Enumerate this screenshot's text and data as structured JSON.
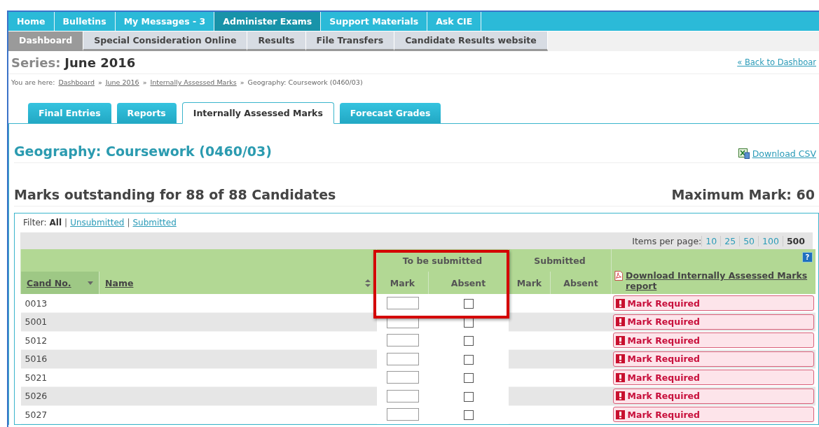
{
  "top_nav": [
    {
      "label": "Home",
      "selected": false
    },
    {
      "label": "Bulletins",
      "selected": false
    },
    {
      "label": "My Messages - 3",
      "selected": false
    },
    {
      "label": "Administer Exams",
      "selected": true
    },
    {
      "label": "Support Materials",
      "selected": false
    },
    {
      "label": "Ask CIE",
      "selected": false
    }
  ],
  "sub_nav": [
    {
      "label": "Dashboard",
      "selected": true
    },
    {
      "label": "Special Consideration Online",
      "selected": false
    },
    {
      "label": "Results",
      "selected": false
    },
    {
      "label": "File Transfers",
      "selected": false
    },
    {
      "label": "Candidate Results website",
      "selected": false
    }
  ],
  "series": {
    "label": "Series:",
    "value": "June 2016"
  },
  "back_link": "« Back to Dashboar",
  "breadcrumb": {
    "prefix": "You are here:",
    "separator": "»",
    "items": [
      {
        "label": "Dashboard",
        "link": true
      },
      {
        "label": "June 2016",
        "link": true
      },
      {
        "label": "Internally Assessed Marks",
        "link": true
      },
      {
        "label": "Geography: Coursework (0460/03)",
        "link": false
      }
    ]
  },
  "tabs": [
    {
      "label": "Final Entries",
      "selected": false
    },
    {
      "label": "Reports",
      "selected": false
    },
    {
      "label": "Internally Assessed Marks",
      "selected": true
    },
    {
      "label": "Forecast Grades",
      "selected": false
    }
  ],
  "subject_title": "Geography: Coursework (0460/03)",
  "download_csv": "Download CSV",
  "outstanding": "Marks outstanding for 88 of 88 Candidates",
  "maximum_mark": "Maximum Mark: 60",
  "filter": {
    "label": "Filter:",
    "separator": "|",
    "options": [
      {
        "label": "All",
        "selected": true
      },
      {
        "label": "Unsubmitted",
        "selected": false
      },
      {
        "label": "Submitted",
        "selected": false
      }
    ]
  },
  "per_page": {
    "label": "Items per page:",
    "options": [
      {
        "label": "10",
        "selected": false
      },
      {
        "label": "25",
        "selected": false
      },
      {
        "label": "50",
        "selected": false
      },
      {
        "label": "100",
        "selected": false
      },
      {
        "label": "500",
        "selected": true
      }
    ]
  },
  "table": {
    "to_be_submitted": "To be submitted",
    "submitted": "Submitted",
    "highlight": true,
    "help": "?",
    "columns": [
      {
        "label": "Cand No.",
        "sorted": true
      },
      {
        "label": "Name",
        "sorted": false
      }
    ],
    "sub_columns": [
      "Mark",
      "Absent",
      "Mark",
      "Absent"
    ],
    "download_report": "Download Internally Assessed Marks report",
    "rows": [
      {
        "cand_no": "0013",
        "absent": false,
        "status": "Mark Required"
      },
      {
        "cand_no": "5001",
        "absent": false,
        "status": "Mark Required"
      },
      {
        "cand_no": "5012",
        "absent": false,
        "status": "Mark Required"
      },
      {
        "cand_no": "5016",
        "absent": false,
        "status": "Mark Required"
      },
      {
        "cand_no": "5021",
        "absent": false,
        "status": "Mark Required"
      },
      {
        "cand_no": "5026",
        "absent": false,
        "status": "Mark Required"
      },
      {
        "cand_no": "5027",
        "absent": false,
        "status": "Mark Required"
      }
    ]
  }
}
